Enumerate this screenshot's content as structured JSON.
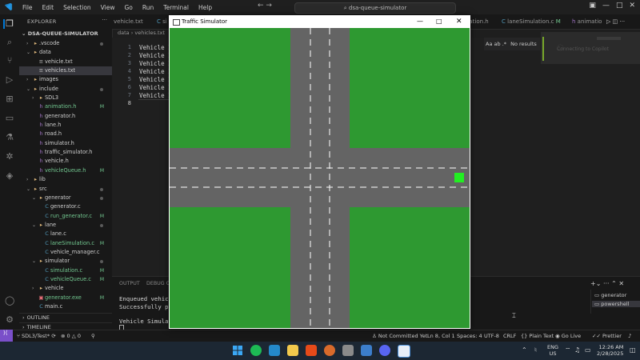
{
  "titlebar": {
    "menu": [
      "File",
      "Edit",
      "Selection",
      "View",
      "Go",
      "Run",
      "Terminal",
      "Help"
    ],
    "command_center": "dsa-queue-simulator"
  },
  "sidebar": {
    "header": "EXPLORER",
    "root": "DSA-QUEUE-SIMULATOR",
    "items": [
      {
        "label": ".vscode",
        "kind": "folder",
        "indent": 1,
        "open": false,
        "dot": true
      },
      {
        "label": "data",
        "kind": "folder",
        "indent": 1,
        "open": true,
        "dot": false
      },
      {
        "label": "vehicle.txt",
        "kind": "file",
        "indent": 2,
        "dot": false
      },
      {
        "label": "vehicles.txt",
        "kind": "file",
        "indent": 2,
        "selected": true,
        "dot": false
      },
      {
        "label": "images",
        "kind": "folder",
        "indent": 1,
        "open": false,
        "dot": false
      },
      {
        "label": "include",
        "kind": "folder",
        "indent": 1,
        "open": true,
        "dot": true
      },
      {
        "label": "SDL3",
        "kind": "folder",
        "indent": 2,
        "open": false,
        "dot": false
      },
      {
        "label": "animation.h",
        "kind": "h",
        "indent": 2,
        "badge": "M"
      },
      {
        "label": "generator.h",
        "kind": "h",
        "indent": 2
      },
      {
        "label": "lane.h",
        "kind": "h",
        "indent": 2
      },
      {
        "label": "road.h",
        "kind": "h",
        "indent": 2
      },
      {
        "label": "simulator.h",
        "kind": "h",
        "indent": 2
      },
      {
        "label": "traffic_simulator.h",
        "kind": "h",
        "indent": 2
      },
      {
        "label": "vehicle.h",
        "kind": "h",
        "indent": 2
      },
      {
        "label": "vehicleQueue.h",
        "kind": "h",
        "indent": 2,
        "badge": "M"
      },
      {
        "label": "lib",
        "kind": "folder",
        "indent": 1,
        "open": false
      },
      {
        "label": "src",
        "kind": "folder",
        "indent": 1,
        "open": true,
        "dot": true
      },
      {
        "label": "generator",
        "kind": "folder",
        "indent": 2,
        "open": true,
        "dot": true
      },
      {
        "label": "generator.c",
        "kind": "c",
        "indent": 3
      },
      {
        "label": "run_generator.c",
        "kind": "c",
        "indent": 3,
        "badge": "M"
      },
      {
        "label": "lane",
        "kind": "folder",
        "indent": 2,
        "open": true,
        "dot": true
      },
      {
        "label": "lane.c",
        "kind": "c",
        "indent": 3
      },
      {
        "label": "laneSimulation.c",
        "kind": "c",
        "indent": 3,
        "badge": "M"
      },
      {
        "label": "vehicle_manager.c",
        "kind": "c",
        "indent": 3
      },
      {
        "label": "simulator",
        "kind": "folder",
        "indent": 2,
        "open": true,
        "dot": true
      },
      {
        "label": "simulation.c",
        "kind": "c",
        "indent": 3,
        "badge": "M"
      },
      {
        "label": "vehicleQueue.c",
        "kind": "c",
        "indent": 3,
        "badge": "M"
      },
      {
        "label": "vehicle",
        "kind": "folder",
        "indent": 2,
        "open": false
      },
      {
        "label": "generator.exe",
        "kind": "exe",
        "indent": 2,
        "badge": "M"
      },
      {
        "label": "main.c",
        "kind": "c",
        "indent": 2
      }
    ],
    "outline": "OUTLINE",
    "timeline": "TIMELINE"
  },
  "tabs": [
    {
      "label": "vehicle.txt"
    },
    {
      "label": "si"
    },
    {
      "label": "ulation.h"
    },
    {
      "label": "laneSimulation.c",
      "badge": "M"
    },
    {
      "label": "animatio"
    }
  ],
  "breadcrumb": {
    "a": "data",
    "b": "vehicles.txt"
  },
  "editor": {
    "lines": [
      "Vehicle I",
      "Vehicle I",
      "Vehicle I",
      "Vehicle I",
      "Vehicle I",
      "Vehicle I",
      "Vehicle I",
      ""
    ],
    "line_numbers": [
      "1",
      "2",
      "3",
      "4",
      "5",
      "6",
      "7",
      "8"
    ]
  },
  "findbar": {
    "text": "No results",
    "aa": "Aa"
  },
  "minimap": {
    "text": "Connecting to Copilot"
  },
  "panel": {
    "tabs": [
      "OUTPUT",
      "DEBUG CO"
    ],
    "lines": [
      "Enqueued vehicle",
      "Successfully pars",
      "",
      "Vehicle Simulatio"
    ],
    "terminals": [
      "generator",
      "powershell"
    ]
  },
  "statusbar": {
    "branch": "SDL3/Test*",
    "problems": "0",
    "warnings": "0",
    "not_committed": "Not Committed Yet",
    "position": "Ln 8, Col 1",
    "spaces": "Spaces: 4",
    "encoding": "UTF-8",
    "eol": "CRLF",
    "language": "Plain Text",
    "golive": "Go Live",
    "prettier": "Prettier"
  },
  "simulator": {
    "title": "Traffic Simulator",
    "colors": {
      "grass": "#2e9931",
      "road": "#646464",
      "lane_line": "#ffffff",
      "vehicle": "#22ee22"
    },
    "vehicle_count": 1
  },
  "taskbar": {
    "lang": "ENG",
    "region": "US",
    "time": "12:26 AM",
    "date": "2/28/2025"
  }
}
